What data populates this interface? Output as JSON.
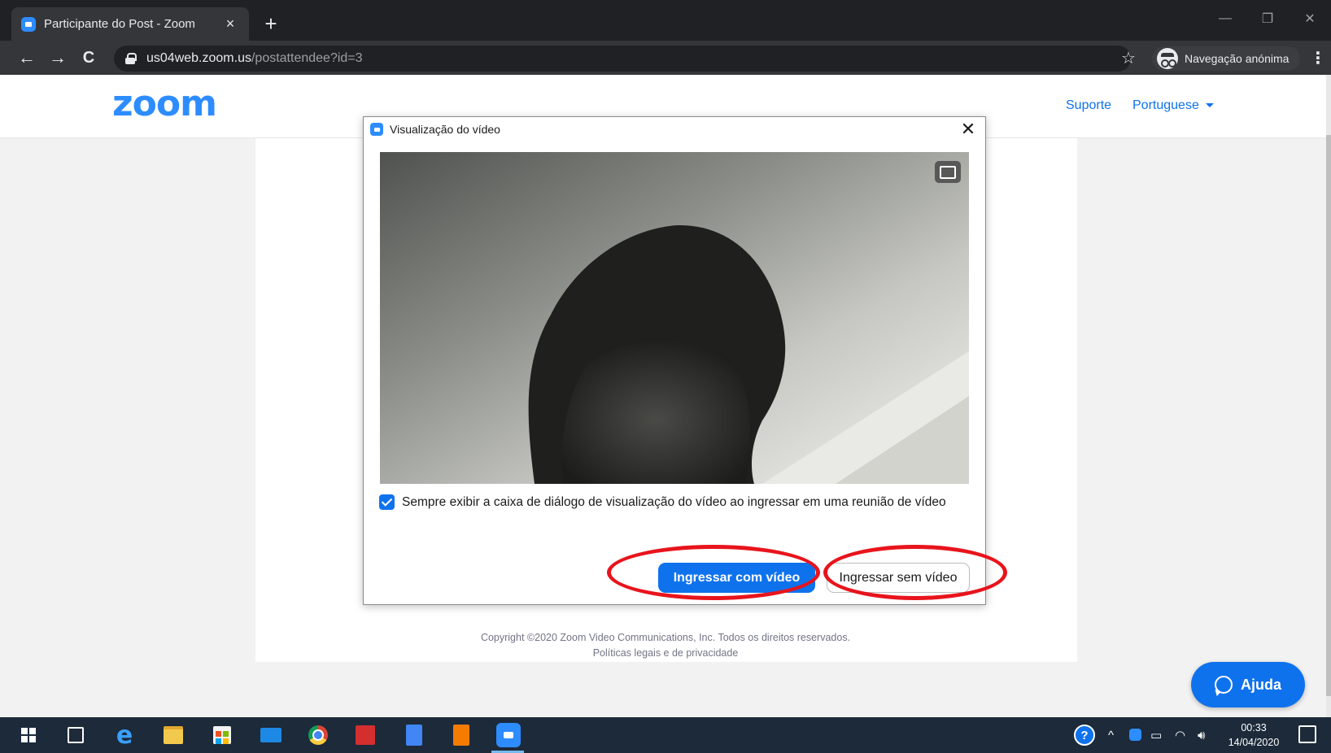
{
  "browser": {
    "tab_title": "Participante do Post - Zoom",
    "tab_close": "×",
    "new_tab": "+",
    "url_host": "us04web.zoom.us",
    "url_path": "/postattendee?id=3",
    "incognito_label": "Navegação anónima",
    "icons": {
      "back": "←",
      "forward": "→",
      "reload": "C",
      "star": "☆",
      "menu": "⋮",
      "minimize": "—",
      "restore": "❐",
      "close": "✕"
    }
  },
  "page": {
    "logo": "zoom",
    "nav": {
      "support": "Suporte",
      "language": "Portuguese"
    },
    "footer": {
      "copyright": "Copyright ©2020 Zoom Video Communications, Inc. Todos os direitos reservados.",
      "legal": "Políticas legais e de privacidade"
    },
    "help_button": "Ajuda"
  },
  "dialog": {
    "title": "Visualização do vídeo",
    "close": "✕",
    "checkbox_label": "Sempre exibir a caixa de diálogo de visualização do vídeo ao ingressar em uma reunião de vídeo",
    "checkbox_checked": true,
    "join_with_video": "Ingressar com vídeo",
    "join_without_video": "Ingressar sem vídeo"
  },
  "taskbar": {
    "tray": {
      "help": "?",
      "chevron": "^",
      "volume": "🔊︎",
      "time": "00:33",
      "date": "14/04/2020"
    }
  },
  "colors": {
    "zoom_blue": "#2d8cff",
    "primary_button": "#0e72ed",
    "annotation_red": "#e8141c",
    "chrome_dark": "#202124"
  }
}
